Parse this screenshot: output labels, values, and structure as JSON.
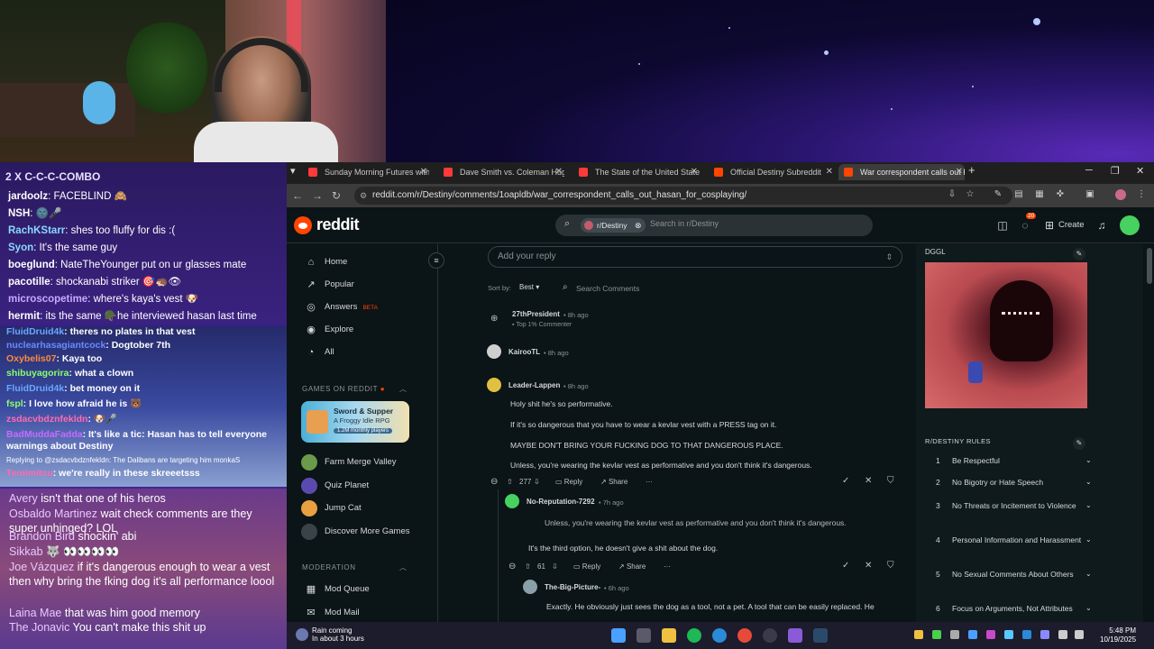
{
  "chat": {
    "header": "2 X C-C-C-COMBO",
    "top": [
      {
        "user": "jardoolz",
        "msg": "FACEBLIND 🙈",
        "color": "#ffffff"
      },
      {
        "user": "NSH",
        "msg": "🌚🎤",
        "color": "#ffffff"
      },
      {
        "user": "RachKStarr",
        "msg": "shes too fluffy for dis :(",
        "color": "#8ad8ff"
      },
      {
        "user": "Syon",
        "msg": "It's the same guy",
        "color": "#8ad8ff"
      },
      {
        "user": "boeglund",
        "msg": "NateTheYounger put on ur glasses mate",
        "color": "#ffffff"
      },
      {
        "user": "pacotille",
        "msg": "shockanabi striker 🎯🦔👁",
        "color": "#ffffff"
      },
      {
        "user": "microscopetime",
        "msg": "where's kaya's vest 🐶",
        "color": "#c8a8ff"
      },
      {
        "user": "hermit",
        "msg": "its the same 🪖he interviewed hasan last time",
        "color": "#ffffff"
      }
    ],
    "mid": [
      {
        "user": "FluidDruid4k",
        "msg": "theres no plates in that vest",
        "color": "#6aa8ff"
      },
      {
        "user": "nuclearhasagiantcock",
        "msg": "Dogtober 7th",
        "color": "#6a8aff"
      },
      {
        "user": "Oxybelis07",
        "msg": "Kaya too",
        "color": "#ff8a3a"
      },
      {
        "user": "shibuyagorira",
        "msg": "what a clown",
        "color": "#8aff6a"
      },
      {
        "user": "FluidDruid4k",
        "msg": "bet money on it",
        "color": "#6aa8ff"
      },
      {
        "user": "fspl",
        "msg": "I love how afraid he is 🐻",
        "color": "#8aff6a"
      },
      {
        "user": "zsdacvbdznfekldn",
        "msg": "🐶🎤",
        "color": "#ff6ab0"
      },
      {
        "user": "BadMuddaFadda",
        "msg": "It's like a tic: Hasan has to tell everyone warnings about Destiny",
        "color": "#c86aff"
      },
      {
        "user": "",
        "msg": "Replying to @zsdacvbdznfekldn: The Dalibans are targeting him monkaS",
        "color": "#ffffff"
      },
      {
        "user": "Temimitsu",
        "msg": "we're really in these skreeetsss",
        "color": "#ff6ab0"
      }
    ],
    "bottom": [
      {
        "user": "Avery",
        "msg": "isn't that one of his heros"
      },
      {
        "user": "Osbaldo Martinez",
        "msg": "wait check comments are they super unhinged? LOL"
      },
      {
        "user": "Brandon Bird",
        "msg": "shockin' abi"
      },
      {
        "user": "Sikkab",
        "msg": "🐺 👀👀👀👀"
      },
      {
        "user": "Joe Vázquez",
        "msg": "if it's dangerous enough to wear a vest then why bring the fking dog it's all performance loool"
      },
      {
        "user": "Laina Mae",
        "msg": "that was him good memory"
      },
      {
        "user": "The Jonavic",
        "msg": "You can't make this shit up"
      }
    ]
  },
  "browser": {
    "tabs": [
      {
        "title": "Sunday Morning Futures with M",
        "fav": "#ff3a3a"
      },
      {
        "title": "Dave Smith vs. Coleman Hughe",
        "fav": "#ff3a3a"
      },
      {
        "title": "The State of the United States:",
        "fav": "#ff3a3a"
      },
      {
        "title": "Official Destiny Subreddit",
        "fav": "#ff4500"
      },
      {
        "title": "War correspondent calls out Ha",
        "fav": "#ff4500"
      }
    ],
    "url": "reddit.com/r/Destiny/comments/1oapldb/war_correspondent_calls_out_hasan_for_cosplaying/"
  },
  "reddit": {
    "brand": "reddit",
    "search_chip": "r/Destiny",
    "search_placeholder": "Search in r/Destiny",
    "create": "Create",
    "notif_count": "20",
    "nav": [
      {
        "label": "Home",
        "icon": "⌂"
      },
      {
        "label": "Popular",
        "icon": "↗"
      },
      {
        "label": "Answers",
        "icon": "◎",
        "badge": "BETA"
      },
      {
        "label": "Explore",
        "icon": "◉"
      },
      {
        "label": "All",
        "icon": "◔"
      }
    ],
    "games_header": "GAMES ON REDDIT",
    "game_card": {
      "title": "Sword & Supper",
      "subtitle": "A Froggy Idle RPG",
      "players": "1.2M monthly players"
    },
    "games": [
      "Farm Merge Valley",
      "Quiz Planet",
      "Jump Cat",
      "Discover More Games"
    ],
    "moderation_header": "MODERATION",
    "mod_items": [
      "Mod Queue",
      "Mod Mail"
    ],
    "reply_placeholder": "Add your reply",
    "sort_label": "Sort by:",
    "sort_value": "Best",
    "search_comments": "Search Comments",
    "comments": [
      {
        "user": "27thPresident",
        "time": "8h ago",
        "flair": "Top 1% Commenter"
      },
      {
        "user": "KairooTL",
        "time": "8h ago"
      },
      {
        "user": "Leader-Lappen",
        "time": "8h ago",
        "lines": [
          "Holy shit he's so performative.",
          "If it's so dangerous that you have to wear a kevlar vest with a PRESS tag on it.",
          "MAYBE DON'T BRING YOUR FUCKING DOG TO THAT DANGEROUS PLACE.",
          "Unless, you're wearing the kevlar vest as performative and you don't think it's dangerous."
        ],
        "votes": "277"
      },
      {
        "user": "No-Reputation-7292",
        "time": "7h ago",
        "lines": [
          "Unless, you're wearing the kevlar vest as performative and you don't think it's dangerous.",
          "It's the third option, he doesn't give a shit about the dog."
        ],
        "votes": "61"
      },
      {
        "user": "The-Big-Picture-",
        "time": "6h ago",
        "lines": [
          "Exactly. He obviously just sees the dog as a tool, not a pet. A tool that can be easily replaced. He"
        ]
      }
    ],
    "actions": {
      "reply": "Reply",
      "share": "Share",
      "more": "···"
    },
    "sidebar_title": "DGGL",
    "rules_header": "R/DESTINY RULES",
    "rules": [
      "Be Respectful",
      "No Bigotry or Hate Speech",
      "No Threats or Incitement to Violence",
      "Personal Information and Harassment",
      "No Sexual Comments About Others",
      "Focus on Arguments, Not Attributes"
    ]
  },
  "taskbar": {
    "weather_line1": "Rain coming",
    "weather_line2": "In about 3 hours",
    "time": "5:48 PM",
    "date": "10/19/2025"
  }
}
